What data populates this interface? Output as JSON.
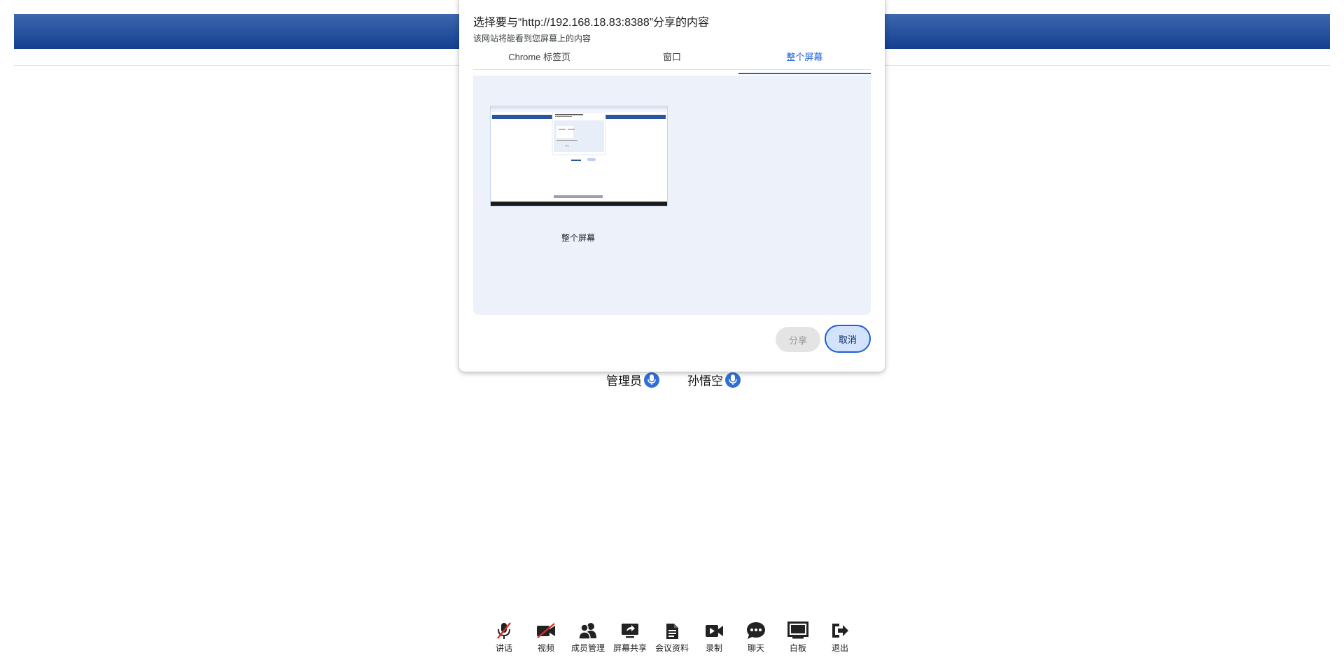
{
  "dialog": {
    "title": "选择要与“http://192.168.18.83:8388”分享的内容",
    "subtitle": "该网站将能看到您屏幕上的内容",
    "tabs": [
      {
        "label": "Chrome 标签页"
      },
      {
        "label": "窗口"
      },
      {
        "label": "整个屏幕"
      }
    ],
    "active_tab": "整个屏幕",
    "thumbnail_label": "整个屏幕",
    "share_label": "分享",
    "cancel_label": "取消"
  },
  "participants": [
    {
      "name": "管理员",
      "icon": "mic-icon"
    },
    {
      "name": "孙悟空",
      "icon": "mic-icon"
    }
  ],
  "toolbar": [
    {
      "label": "讲话",
      "icon": "mic-muted-icon"
    },
    {
      "label": "视频",
      "icon": "video-off-icon"
    },
    {
      "label": "成员管理",
      "icon": "users-icon"
    },
    {
      "label": "屏幕共享",
      "icon": "screen-share-icon"
    },
    {
      "label": "会议资料",
      "icon": "document-icon"
    },
    {
      "label": "录制",
      "icon": "record-icon"
    },
    {
      "label": "聊天",
      "icon": "chat-icon"
    },
    {
      "label": "白板",
      "icon": "whiteboard-icon"
    },
    {
      "label": "退出",
      "icon": "exit-icon"
    }
  ],
  "colors": {
    "banner_top": "#3d67ae",
    "banner_bottom": "#123f8f",
    "accent": "#1a5fd6",
    "mute_red": "#d93025"
  }
}
